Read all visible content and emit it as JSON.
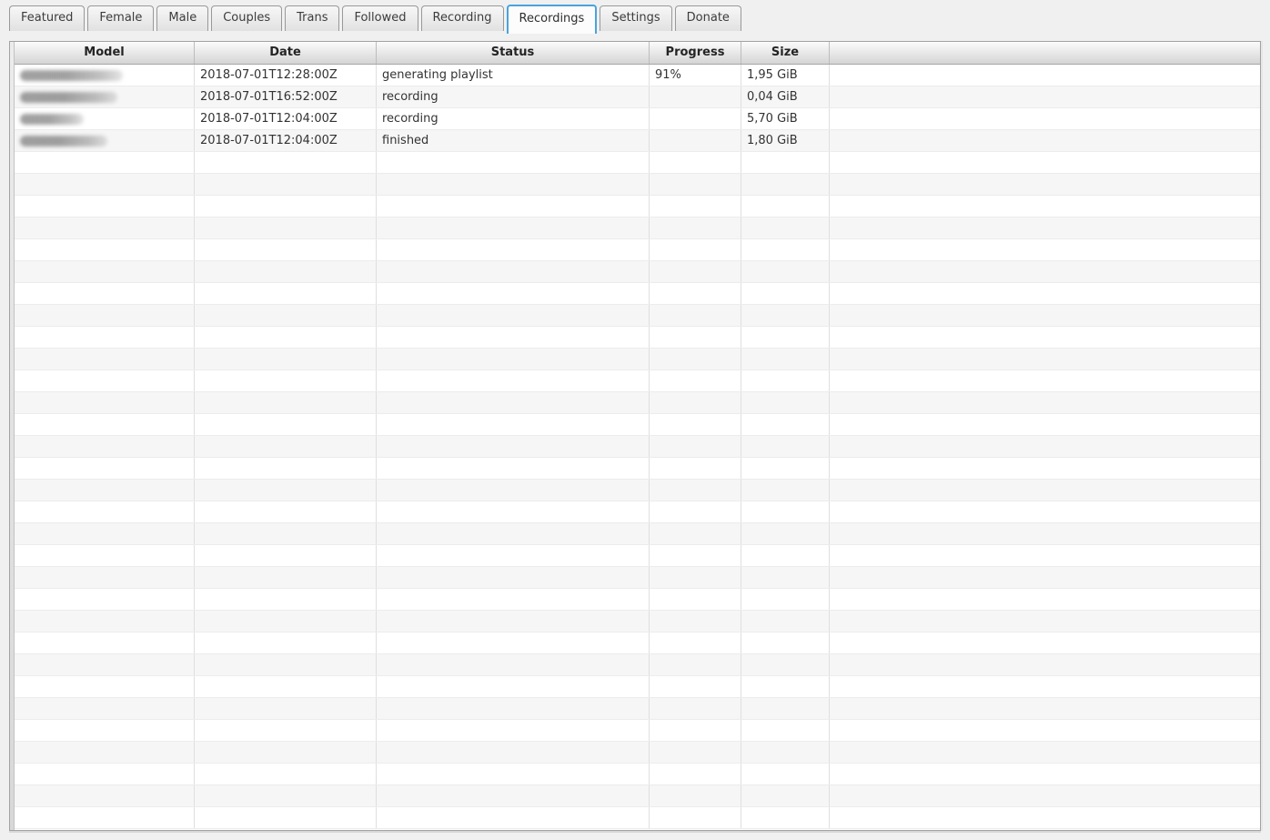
{
  "app": {
    "active_tab": "Recordings"
  },
  "tabs": [
    {
      "label": "Featured"
    },
    {
      "label": "Female"
    },
    {
      "label": "Male"
    },
    {
      "label": "Couples"
    },
    {
      "label": "Trans"
    },
    {
      "label": "Followed"
    },
    {
      "label": "Recording"
    },
    {
      "label": "Recordings"
    },
    {
      "label": "Settings"
    },
    {
      "label": "Donate"
    }
  ],
  "table": {
    "columns": [
      {
        "label": "Model"
      },
      {
        "label": "Date"
      },
      {
        "label": "Status"
      },
      {
        "label": "Progress"
      },
      {
        "label": "Size"
      },
      {
        "label": ""
      }
    ],
    "rows": [
      {
        "model": "",
        "model_redacted": true,
        "model_blur_width": 113,
        "date": "2018-07-01T12:28:00Z",
        "status": "generating playlist",
        "progress": "91%",
        "size": "1,95 GiB"
      },
      {
        "model": "",
        "model_redacted": true,
        "model_blur_width": 107,
        "date": "2018-07-01T16:52:00Z",
        "status": "recording",
        "progress": "",
        "size": "0,04 GiB"
      },
      {
        "model": "",
        "model_redacted": true,
        "model_blur_width": 70,
        "date": "2018-07-01T12:04:00Z",
        "status": "recording",
        "progress": "",
        "size": "5,70 GiB"
      },
      {
        "model": "",
        "model_redacted": true,
        "model_blur_width": 96,
        "date": "2018-07-01T12:04:00Z",
        "status": "finished",
        "progress": "",
        "size": "1,80 GiB"
      }
    ],
    "empty_row_count": 31
  },
  "colors": {
    "accent_active_tab_border": "#4aa3dd",
    "window_background": "#f0f0f0",
    "row_stripe": "#f6f6f6",
    "header_text": "#242424",
    "cell_text": "#333333"
  }
}
